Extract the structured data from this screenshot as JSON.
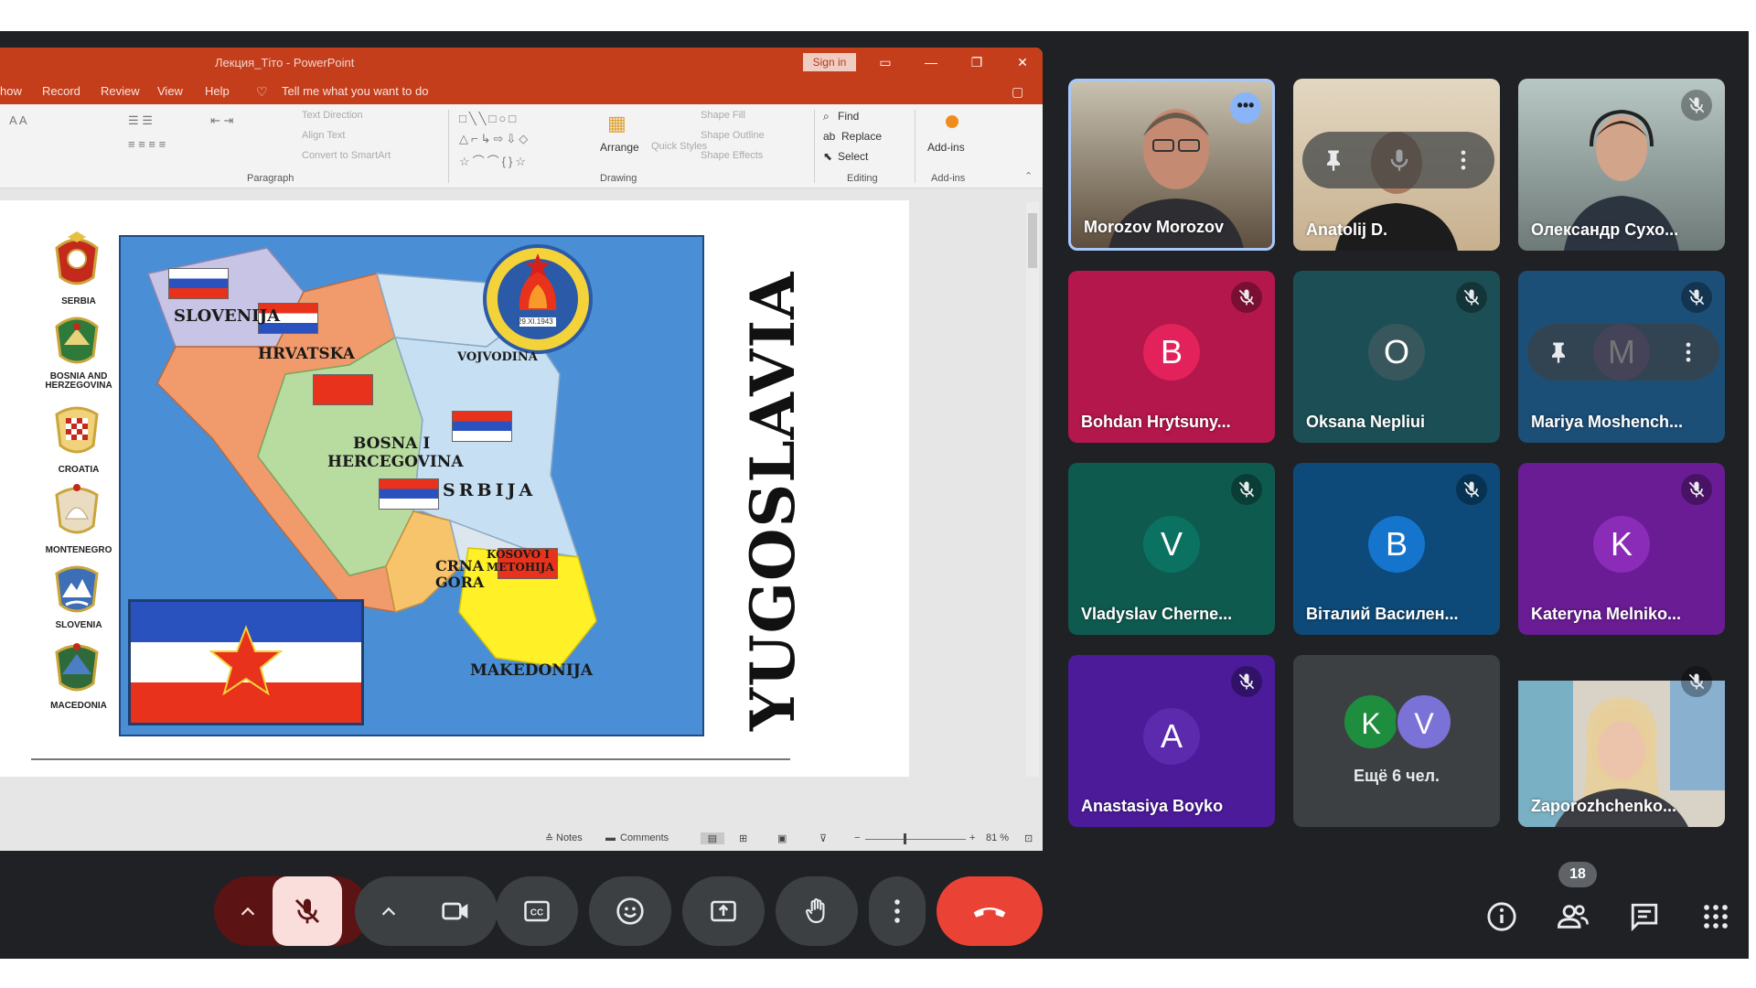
{
  "presentation": {
    "window_title": "Лекция_Тіто - PowerPoint",
    "sign_in": "Sign in",
    "menu": [
      "how",
      "Record",
      "Review",
      "View",
      "Help"
    ],
    "tell_me": "Tell me what you want to do",
    "ribbon": {
      "paragraph_label": "Paragraph",
      "drawing_label": "Drawing",
      "editing_label": "Editing",
      "addins_label": "Add-ins",
      "text_direction": "Text Direction",
      "align_text": "Align Text",
      "convert_smartart": "Convert to SmartArt",
      "arrange": "Arrange",
      "quick_styles": "Quick Styles",
      "shape_fill": "Shape Fill",
      "shape_outline": "Shape Outline",
      "shape_effects": "Shape Effects",
      "find": "Find",
      "replace": "Replace",
      "select": "Select",
      "addins": "Add-ins"
    },
    "status": {
      "notes": "Notes",
      "comments": "Comments",
      "zoom": "81 %"
    },
    "slide": {
      "title": "YUGOSLAVIA",
      "coats": [
        "SERBIA",
        "BOSNIA AND HERZEGOVINA",
        "CROATIA",
        "MONTENEGRO",
        "SLOVENIA",
        "MACEDONIA"
      ],
      "regions": {
        "slovenija": "SLOVENIJA",
        "hrvatska": "HRVATSKA",
        "vojvodina": "VOJVODINA",
        "bosna_1": "BOSNA I",
        "bosna_2": "HERCEGOVINA",
        "srbija": "SRBIJA",
        "crna_1": "CRNA",
        "crna_2": "GORA",
        "kosovo_1": "KOSOVO I",
        "kosovo_2": "METOHIJA",
        "makedonija": "MAKEDONIJA"
      },
      "emblem_date": "29.XI.1943"
    }
  },
  "participants": [
    {
      "name": "Morozov Morozov",
      "type": "video"
    },
    {
      "name": "Anatolij D.",
      "type": "video"
    },
    {
      "name": "Олександр Сухо...",
      "type": "video"
    },
    {
      "name": "Bohdan Hrytsuny...",
      "initial": "B",
      "bg": "#b3174c",
      "avatar": "#e3225c"
    },
    {
      "name": "Oksana Nepliui",
      "initial": "O",
      "bg": "#1c4f55",
      "avatar": "#37575d"
    },
    {
      "name": "Mariya Moshench...",
      "initial": "M",
      "bg": "#1c4f78",
      "avatar": "#5a4e8c"
    },
    {
      "name": "Vladyslav Cherne...",
      "initial": "V",
      "bg": "#0f5a4f",
      "avatar": "#0b7262"
    },
    {
      "name": "Віталий Василен...",
      "initial": "B",
      "bg": "#0d4a79",
      "avatar": "#1574cc"
    },
    {
      "name": "Kateryna Melniko...",
      "initial": "K",
      "bg": "#6a1c94",
      "avatar": "#8a2cb8"
    },
    {
      "name": "Anastasiya Boyko",
      "initial": "A",
      "bg": "#4b1b9a",
      "avatar": "#5b2aad"
    },
    {
      "name": "Ещё 6 чел.",
      "type": "more",
      "initials": [
        "K",
        "V"
      ]
    },
    {
      "name": "Zaporozhchenko...",
      "type": "video"
    }
  ],
  "people_count": "18",
  "colors": {
    "ppt_accent": "#c43e1c",
    "meet_bg": "#202124",
    "end_call": "#ea4335",
    "mic_off_active": "#f9dedc"
  }
}
